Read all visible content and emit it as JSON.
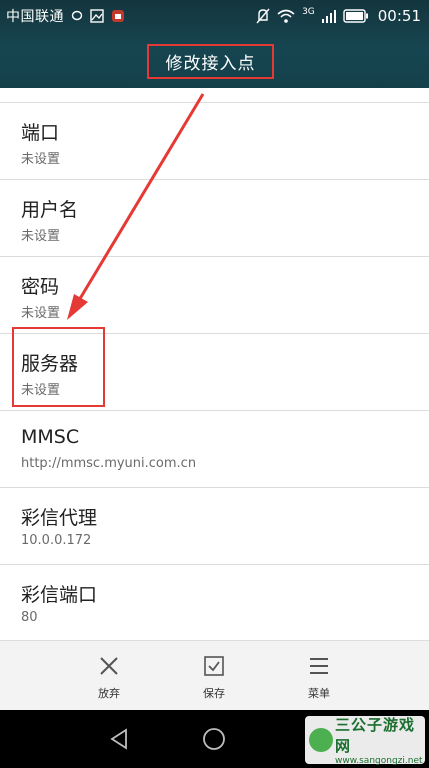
{
  "status": {
    "carrier": "中国联通",
    "network": "3G",
    "time": "00:51"
  },
  "header": {
    "title": "修改接入点"
  },
  "items": [
    {
      "title": "端口",
      "value": "未设置"
    },
    {
      "title": "用户名",
      "value": "未设置"
    },
    {
      "title": "密码",
      "value": "未设置"
    },
    {
      "title": "服务器",
      "value": "未设置"
    },
    {
      "title": "MMSC",
      "value": "http://mmsc.myuni.com.cn"
    },
    {
      "title": "彩信代理",
      "value": "10.0.0.172"
    },
    {
      "title": "彩信端口",
      "value": "80"
    }
  ],
  "actions": {
    "discard": "放弃",
    "save": "保存",
    "menu": "菜单"
  },
  "watermark": {
    "title": "三公子游戏网",
    "url": "www.sangongzi.net"
  },
  "colors": {
    "header_bg": "#164550",
    "annotation_red": "#e53935"
  }
}
